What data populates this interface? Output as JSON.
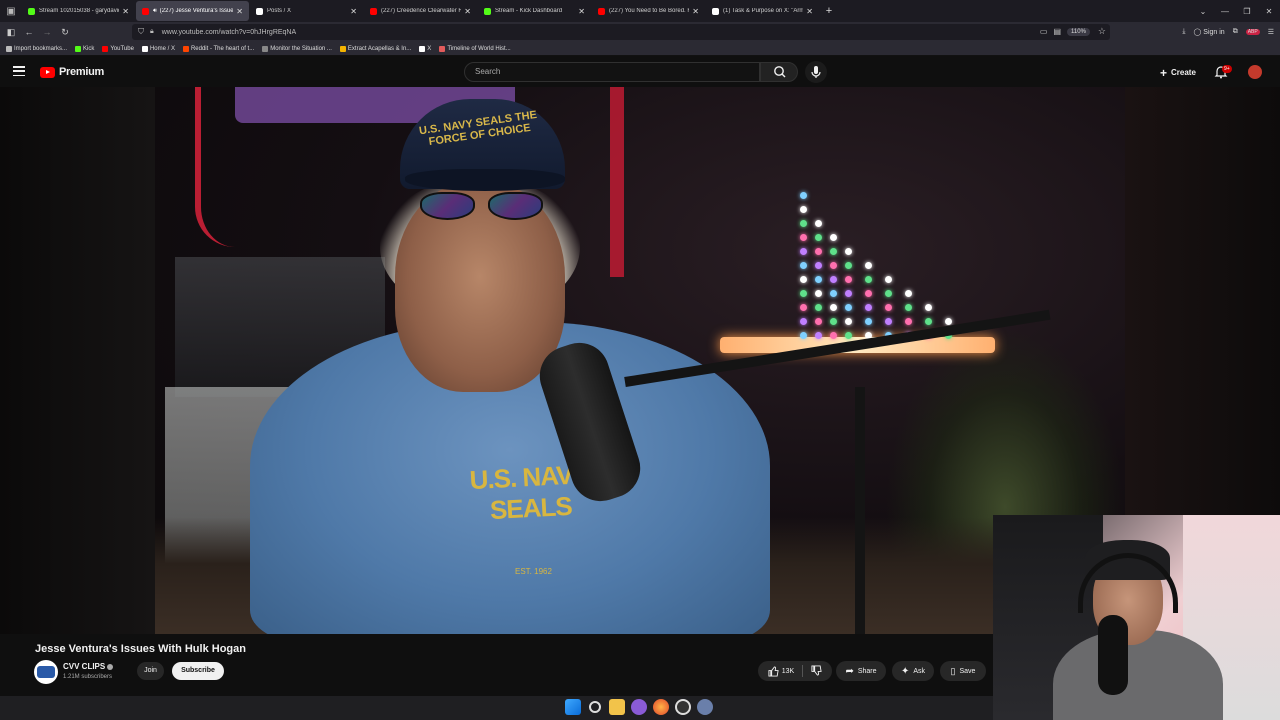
{
  "browser": {
    "tabs": [
      {
        "label": "Stream 102015038 - garydavid",
        "color": "#53fc18",
        "active": false
      },
      {
        "label": "(227) Jesse Ventura's Issues",
        "color": "#ff0000",
        "active": true
      },
      {
        "label": "Posts / X",
        "color": "#ffffff",
        "active": false
      },
      {
        "label": "(227) Creedence Clearwater Re",
        "color": "#ff0000",
        "active": false
      },
      {
        "label": "Stream - Kick Dashboard",
        "color": "#53fc18",
        "active": false
      },
      {
        "label": "(227) You Need to Be Bored. H",
        "color": "#ff0000",
        "active": false
      },
      {
        "label": "(1) Task & Purpose on X: \"Army",
        "color": "#ffffff",
        "active": false
      }
    ],
    "url": "www.youtube.com/watch?v=0hJHrgREqNA",
    "zoom": "110%",
    "sign_in": "Sign in",
    "bookmarks": [
      {
        "label": "Import bookmarks...",
        "color": "#bbbbbb"
      },
      {
        "label": "Kick",
        "color": "#53fc18"
      },
      {
        "label": "YouTube",
        "color": "#ff0000"
      },
      {
        "label": "Home / X",
        "color": "#ffffff"
      },
      {
        "label": "Reddit - The heart of t...",
        "color": "#ff4500"
      },
      {
        "label": "Monitor the Situation ...",
        "color": "#888888"
      },
      {
        "label": "Extract Acapellas & In...",
        "color": "#f4b400"
      },
      {
        "label": "X",
        "color": "#ffffff"
      },
      {
        "label": "Timeline of World Hist...",
        "color": "#e25b5b"
      }
    ]
  },
  "youtube": {
    "logo_text": "Premium",
    "search_placeholder": "Search",
    "create_label": "Create",
    "notif_count": "9+",
    "video_title": "Jesse Ventura's Issues With Hulk Hogan",
    "channel_name": "CVV CLIPS",
    "subscribers": "1.21M subscribers",
    "join_label": "Join",
    "subscribe_label": "Subscribe",
    "likes": "13K",
    "share_label": "Share",
    "ask_label": "Ask",
    "save_label": "Save"
  },
  "video_scene": {
    "cap_text": "U.S. NAVY SEALS THE FORCE OF CHOICE",
    "shirt_text": "U.S. NAVY SEALS",
    "shirt_sub": "EST. 1962"
  },
  "colors": {
    "accent_red": "#ff0000",
    "page_bg": "#0f0f0f"
  }
}
